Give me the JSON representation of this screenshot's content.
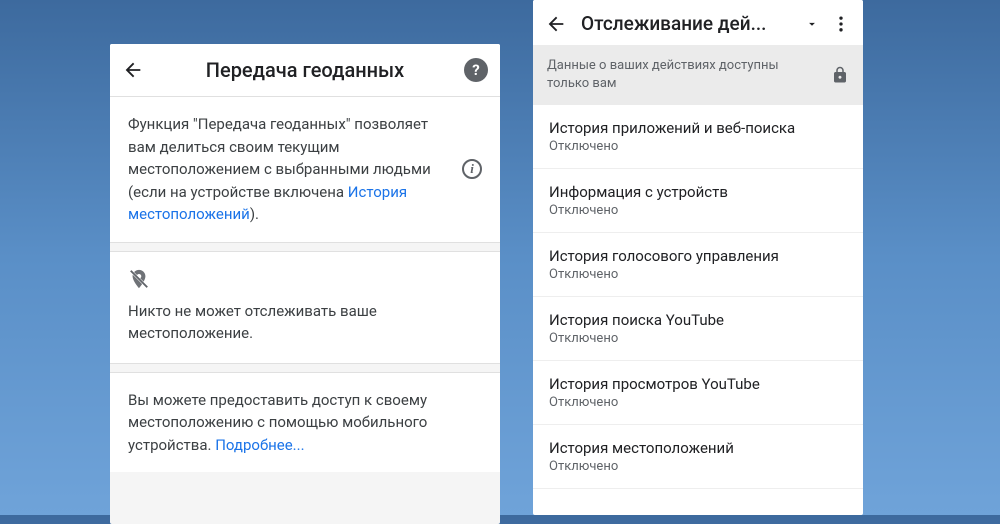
{
  "left": {
    "title": "Передача геоданных",
    "help_glyph": "?",
    "description_part1": "Функция \"Передача геоданных\" позволяет вам делиться своим текущим местоположением с выбранными людьми (если на устройстве включена ",
    "description_link": "История местоположений",
    "description_part2": ").",
    "info_glyph": "i",
    "nobody_text": "Никто не может отслеживать ваше местоположение.",
    "access_text": "Вы можете предоставить доступ к своему местоположению с помощью мобильного устройства. ",
    "access_link": "Подробнее..."
  },
  "right": {
    "title": "Отслеживание дей...",
    "privacy_text": "Данные о ваших действиях доступны только вам",
    "items": [
      {
        "title": "История приложений и веб-поиска",
        "status": "Отключено"
      },
      {
        "title": "Информация с устройств",
        "status": "Отключено"
      },
      {
        "title": "История голосового управления",
        "status": "Отключено"
      },
      {
        "title": "История поиска YouTube",
        "status": "Отключено"
      },
      {
        "title": "История просмотров YouTube",
        "status": "Отключено"
      },
      {
        "title": "История местоположений",
        "status": "Отключено"
      }
    ]
  }
}
